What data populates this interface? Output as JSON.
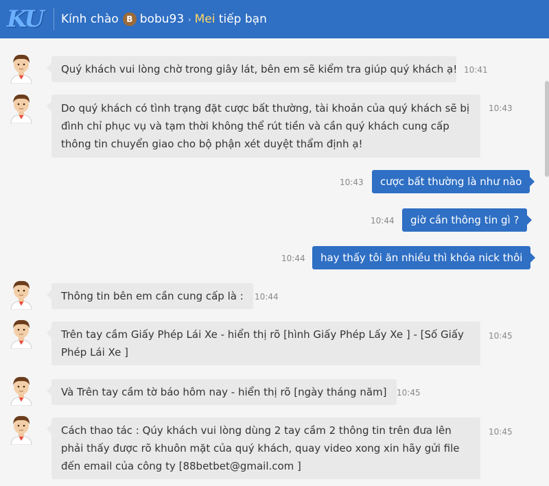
{
  "header": {
    "logo": "KU",
    "greeting": "Kính chào",
    "badge": "B",
    "username": "bobu93",
    "separator": "›",
    "mei": "Mei",
    "invite": "tiếp bạn"
  },
  "messages": [
    {
      "from": "agent",
      "text": "Quý khách vui lòng chờ trong giây lát, bên em sẽ kiểm tra giúp quý khách ạ!",
      "time": "10:41"
    },
    {
      "from": "agent",
      "text": "Do quý khách có tình trạng đặt cược bất thường, tài khoản của quý khách sẽ bị đình chỉ phục vụ và tạm thời không thể rút tiền và cần quý khách cung cấp thông tin chuyển giao cho bộ phận xét duyệt thẩm định ạ!",
      "time": "10:43"
    },
    {
      "from": "user",
      "text": "cược bất thường là như nào",
      "time": "10:43"
    },
    {
      "from": "user",
      "text": "giờ cần thông tin gì ?",
      "time": "10:44"
    },
    {
      "from": "user",
      "text": "hay thấy tôi ăn nhiều thì khóa nick thôi",
      "time": "10:44"
    },
    {
      "from": "agent",
      "text": "Thông tin bên em cần cung cấp là :",
      "time": "10:44"
    },
    {
      "from": "agent",
      "text": "Trên tay cầm Giấy Phép Lái Xe - hiển thị rõ [hình Giấy Phép Lấy Xe ] - [Số Giấy Phép Lái Xe ]",
      "time": "10:45"
    },
    {
      "from": "agent",
      "text": "Và Trên tay cầm tờ báo hôm nay - hiển thị rõ [ngày tháng năm]",
      "time": "10:45"
    },
    {
      "from": "agent",
      "text": "Cách thao tác : Qúy khách vui lòng dùng 2 tay cầm 2 thông tin trên đưa lên phải thấy được rõ khuôn mặt của quý khách, quay video xong xin hãy gửi file đến email của công ty [88betbet@gmail.com ]",
      "time": "10:45"
    }
  ],
  "colors": {
    "header": "#2f6fc4",
    "user_bubble": "#2f6fc4",
    "agent_bubble": "#e9e9e9",
    "mei": "#ffd866"
  }
}
